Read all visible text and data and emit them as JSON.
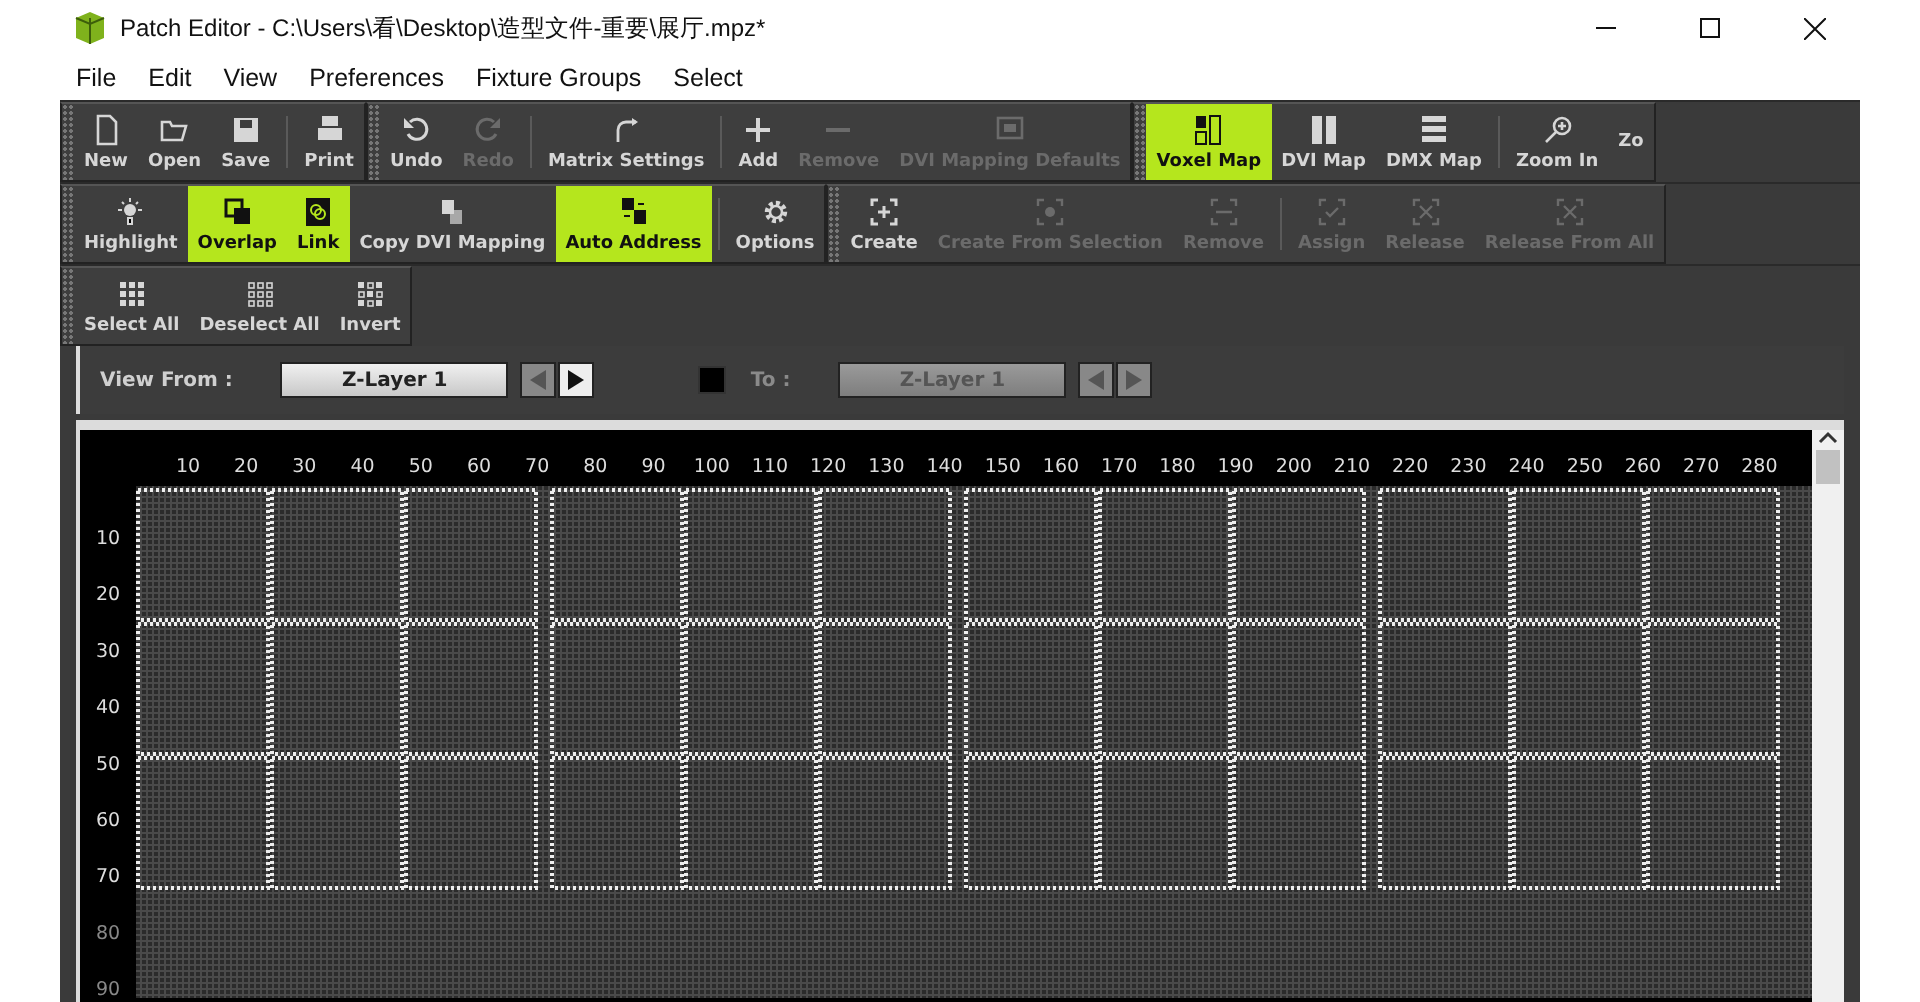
{
  "window": {
    "title": "Patch Editor - C:\\Users\\看\\Desktop\\造型文件-重要\\展厅.mpz*"
  },
  "menu": [
    "File",
    "Edit",
    "View",
    "Preferences",
    "Fixture Groups",
    "Select"
  ],
  "toolbar_rows": [
    {
      "toolbars": [
        {
          "groups": [
            [
              {
                "label": "New",
                "selected": false,
                "disabled": false
              },
              {
                "label": "Open",
                "selected": false,
                "disabled": false
              },
              {
                "label": "Save",
                "selected": false,
                "disabled": false
              }
            ],
            [
              {
                "label": "Print",
                "selected": false,
                "disabled": false
              }
            ]
          ]
        },
        {
          "groups": [
            [
              {
                "label": "Undo",
                "selected": false,
                "disabled": false
              },
              {
                "label": "Redo",
                "selected": false,
                "disabled": true
              }
            ],
            [
              {
                "label": "Matrix Settings",
                "selected": false,
                "disabled": false
              }
            ],
            [
              {
                "label": "Add",
                "selected": false,
                "disabled": false
              },
              {
                "label": "Remove",
                "selected": false,
                "disabled": true
              },
              {
                "label": "DVI Mapping Defaults",
                "selected": false,
                "disabled": true
              }
            ]
          ]
        },
        {
          "groups": [
            [
              {
                "label": "Voxel Map",
                "selected": true,
                "disabled": false
              },
              {
                "label": "DVI Map",
                "selected": false,
                "disabled": false
              },
              {
                "label": "DMX Map",
                "selected": false,
                "disabled": false
              }
            ],
            [
              {
                "label": "Zoom In",
                "selected": false,
                "disabled": false
              },
              {
                "label": "Zo",
                "selected": false,
                "disabled": false
              }
            ]
          ]
        }
      ]
    },
    {
      "toolbars": [
        {
          "groups": [
            [
              {
                "label": "Highlight",
                "selected": false,
                "disabled": false
              },
              {
                "label": "Overlap",
                "selected": true,
                "disabled": false
              },
              {
                "label": "Link",
                "selected": true,
                "disabled": false
              },
              {
                "label": "Copy DVI Mapping",
                "selected": false,
                "disabled": false
              },
              {
                "label": "Auto Address",
                "selected": true,
                "disabled": false
              }
            ],
            [
              {
                "label": "Options",
                "selected": false,
                "disabled": false
              }
            ]
          ]
        },
        {
          "groups": [
            [
              {
                "label": "Create",
                "selected": false,
                "disabled": false
              },
              {
                "label": "Create From Selection",
                "selected": false,
                "disabled": true
              },
              {
                "label": "Remove",
                "selected": false,
                "disabled": true
              }
            ],
            [
              {
                "label": "Assign",
                "selected": false,
                "disabled": true
              },
              {
                "label": "Release",
                "selected": false,
                "disabled": true
              },
              {
                "label": "Release From All",
                "selected": false,
                "disabled": true
              }
            ]
          ]
        }
      ]
    },
    {
      "toolbars": [
        {
          "groups": [
            [
              {
                "label": "Select All",
                "selected": false,
                "disabled": false
              },
              {
                "label": "Deselect All",
                "selected": false,
                "disabled": false
              },
              {
                "label": "Invert",
                "selected": false,
                "disabled": false
              }
            ]
          ]
        }
      ]
    }
  ],
  "view_from": {
    "label": "View From :",
    "value": "Z-Layer 1",
    "previous_enabled": false,
    "next_enabled": true
  },
  "to": {
    "checked": false,
    "label": "To :",
    "value": "Z-Layer 1"
  },
  "matrix": {
    "x_labels": [
      "10",
      "20",
      "30",
      "40",
      "50",
      "60",
      "70",
      "80",
      "90",
      "100",
      "110",
      "120",
      "130",
      "140",
      "150",
      "160",
      "170",
      "180",
      "190",
      "200",
      "210",
      "220",
      "230",
      "240",
      "250",
      "260",
      "270",
      "280"
    ],
    "y_labels": [
      "10",
      "20",
      "30",
      "40",
      "50",
      "60",
      "70",
      "80",
      "90"
    ]
  }
}
